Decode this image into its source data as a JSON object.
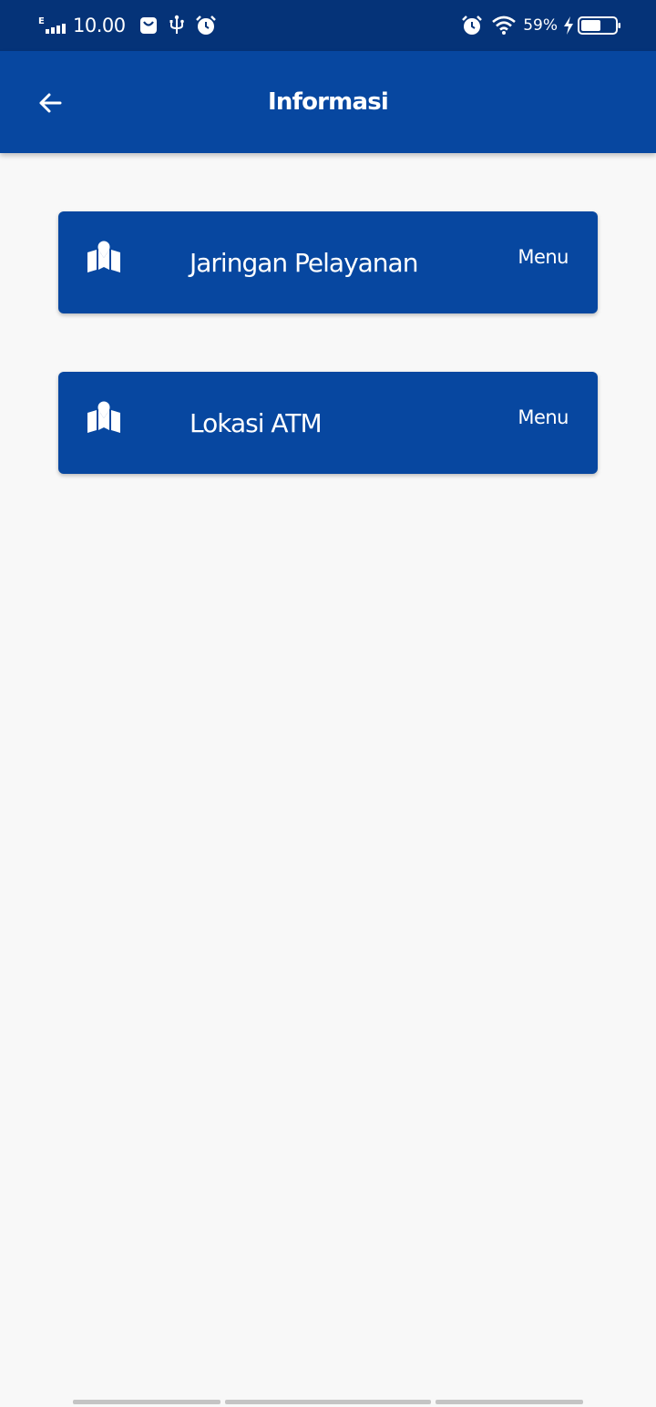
{
  "status_bar": {
    "network_type": "E",
    "time": "10.00",
    "battery_percent": "59%",
    "icons_left": [
      "signal-icon",
      "shopping-bag-icon",
      "usb-icon",
      "alarm-icon"
    ],
    "icons_right": [
      "alarm-icon",
      "wifi-icon",
      "charging-icon",
      "battery-icon"
    ],
    "battery_level": 0.59
  },
  "app_bar": {
    "title": "Informasi",
    "back_icon": "arrow-left-icon",
    "background": "#0747a0"
  },
  "menu_items": [
    {
      "label": "Jaringan Pelayanan",
      "action_label": "Menu",
      "icon": "map-marker-icon"
    },
    {
      "label": "Lokasi ATM",
      "action_label": "Menu",
      "icon": "map-marker-icon"
    }
  ],
  "colors": {
    "status_bar": "#053378",
    "primary": "#0747a0",
    "background": "#f8f8f8",
    "text_on_primary": "#ffffff"
  }
}
